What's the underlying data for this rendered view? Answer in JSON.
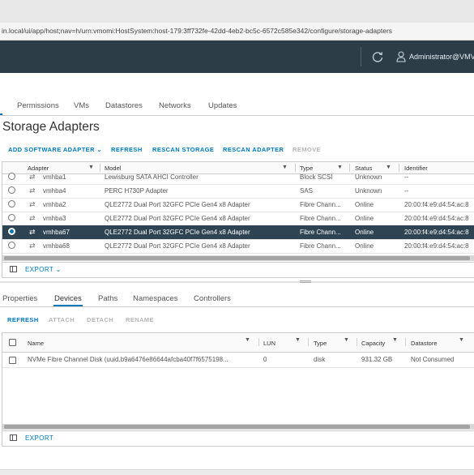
{
  "browser": {
    "url": "in.local/ui/app/host;nav=h/urn:vmomi:HostSystem:host-179:3ff732fe-42dd-4eb2-bc5c-6572c585e342/configure/storage-adapters"
  },
  "header": {
    "user": "Administrator@VMV",
    "refresh_icon": "refresh-icon",
    "user_icon": "user-icon"
  },
  "top_tabs": [
    "Permissions",
    "VMs",
    "Datastores",
    "Networks",
    "Updates"
  ],
  "page": {
    "title": "Storage Adapters"
  },
  "toolbar": {
    "add_software_adapter": "ADD SOFTWARE ADAPTER ⌄",
    "refresh": "REFRESH",
    "rescan_storage": "RESCAN STORAGE",
    "rescan_adapter": "RESCAN ADAPTER",
    "remove": "REMOVE"
  },
  "adapters": {
    "columns": {
      "adapter": "Adapter",
      "model": "Model",
      "type": "Type",
      "status": "Status",
      "identifier": "Identifier"
    },
    "rows": [
      {
        "adapter": "vmhba1",
        "model": "Lewisburg SATA AHCI Controller",
        "type": "Block SCSI",
        "status": "Unknown",
        "identifier": "--"
      },
      {
        "adapter": "vmhba4",
        "model": "PERC H730P Adapter",
        "type": "SAS",
        "status": "Unknown",
        "identifier": "--"
      },
      {
        "adapter": "vmhba2",
        "model": "QLE2772 Dual Port 32GFC PCIe Gen4 x8 Adapter",
        "type": "Fibre Chann...",
        "status": "Online",
        "identifier": "20:00:f4:e9:d4:54:ac:8"
      },
      {
        "adapter": "vmhba3",
        "model": "QLE2772 Dual Port 32GFC PCIe Gen4 x8 Adapter",
        "type": "Fibre Chann...",
        "status": "Online",
        "identifier": "20:00:f4:e9:d4:54:ac:8"
      },
      {
        "adapter": "vmhba67",
        "model": "QLE2772 Dual Port 32GFC PCIe Gen4 x8 Adapter",
        "type": "Fibre Chann...",
        "status": "Online",
        "identifier": "20:00:f4:e9:d4:54:ac:8",
        "selected": true
      },
      {
        "adapter": "vmhba68",
        "model": "QLE2772 Dual Port 32GFC PCIe Gen4 x8 Adapter",
        "type": "Fibre Chann...",
        "status": "Online",
        "identifier": "20:00:f4:e9:d4:54:ac:8"
      }
    ],
    "export": "EXPORT ⌄"
  },
  "bottom_tabs": [
    "Properties",
    "Devices",
    "Paths",
    "Namespaces",
    "Controllers"
  ],
  "bottom_toolbar": {
    "refresh": "REFRESH",
    "attach": "ATTACH",
    "detach": "DETACH",
    "rename": "RENAME"
  },
  "devices": {
    "columns": {
      "name": "Name",
      "lun": "LUN",
      "type": "Type",
      "capacity": "Capacity",
      "datastore": "Datastore"
    },
    "rows": [
      {
        "name": "NVMe Fibre Channel Disk (uuid.b9a6476e86644afcba40f7f6575198...",
        "lun": "0",
        "type": "disk",
        "capacity": "931.32 GB",
        "datastore": "Not Consumed"
      }
    ],
    "export": "EXPORT"
  },
  "colors": {
    "accent": "#0079b8",
    "header": "#2c3d48",
    "selected_row": "#2e4452"
  }
}
